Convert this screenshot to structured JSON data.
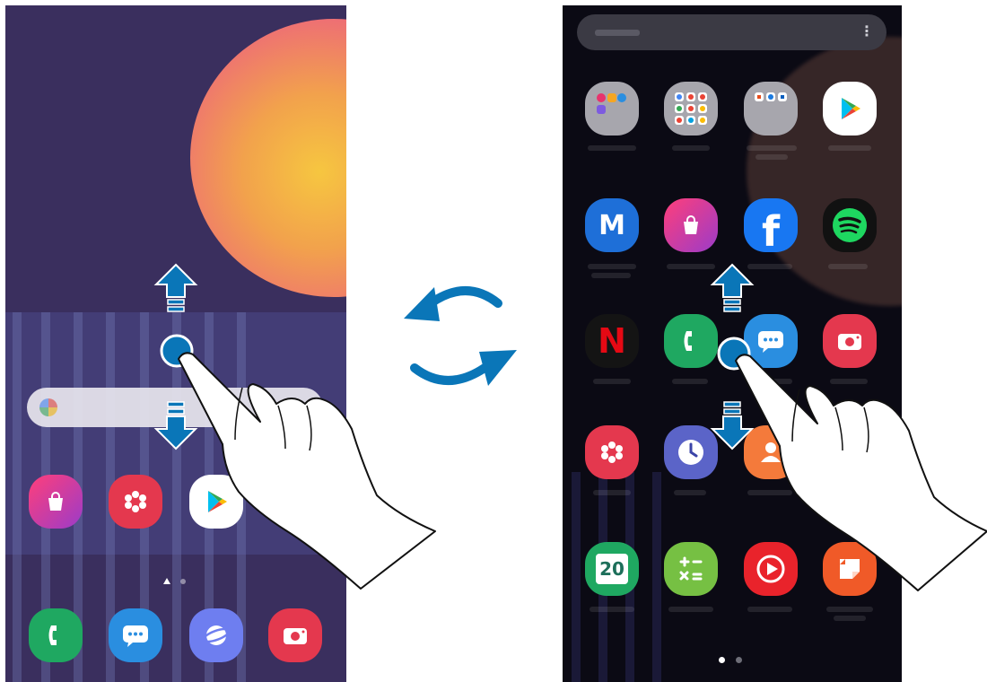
{
  "home_screen": {
    "page_dots": 2,
    "current_page": 1,
    "dock": [
      "phone-icon",
      "messages-icon",
      "internet-icon",
      "camera-icon"
    ],
    "apps": [
      "galaxy-store-icon",
      "gallery-icon",
      "play-store-icon"
    ]
  },
  "apps_screen": {
    "menu_glyph": "⋮",
    "page_dots": 2,
    "current_page": 1,
    "rows": [
      [
        "samsung-folder-icon",
        "google-folder-icon",
        "microsoft-folder-icon",
        "play-store-icon"
      ],
      [
        "samsung-members-icon",
        "galaxy-store-icon",
        "facebook-icon",
        "spotify-icon"
      ],
      [
        "netflix-icon",
        "phone-icon",
        "messages-icon",
        "camera-icon"
      ],
      [
        "gallery-icon",
        "clock-icon",
        "contacts-icon"
      ],
      [
        "calendar-icon",
        "calculator-icon",
        "youtube-music-icon",
        "samsung-notes-icon"
      ]
    ],
    "calendar_date": "20",
    "netflix_letter": "N",
    "facebook_letter": "f",
    "members_letter": "M"
  },
  "gesture": {
    "description_arrows": [
      "swipe-up-arrow",
      "swipe-down-arrow"
    ],
    "switch_arrows": "rotate-arrows"
  },
  "colors": {
    "arrow_blue": "#0a76b8",
    "home_bg": "#3a2f5e",
    "apps_bg": "#0b0a14"
  }
}
